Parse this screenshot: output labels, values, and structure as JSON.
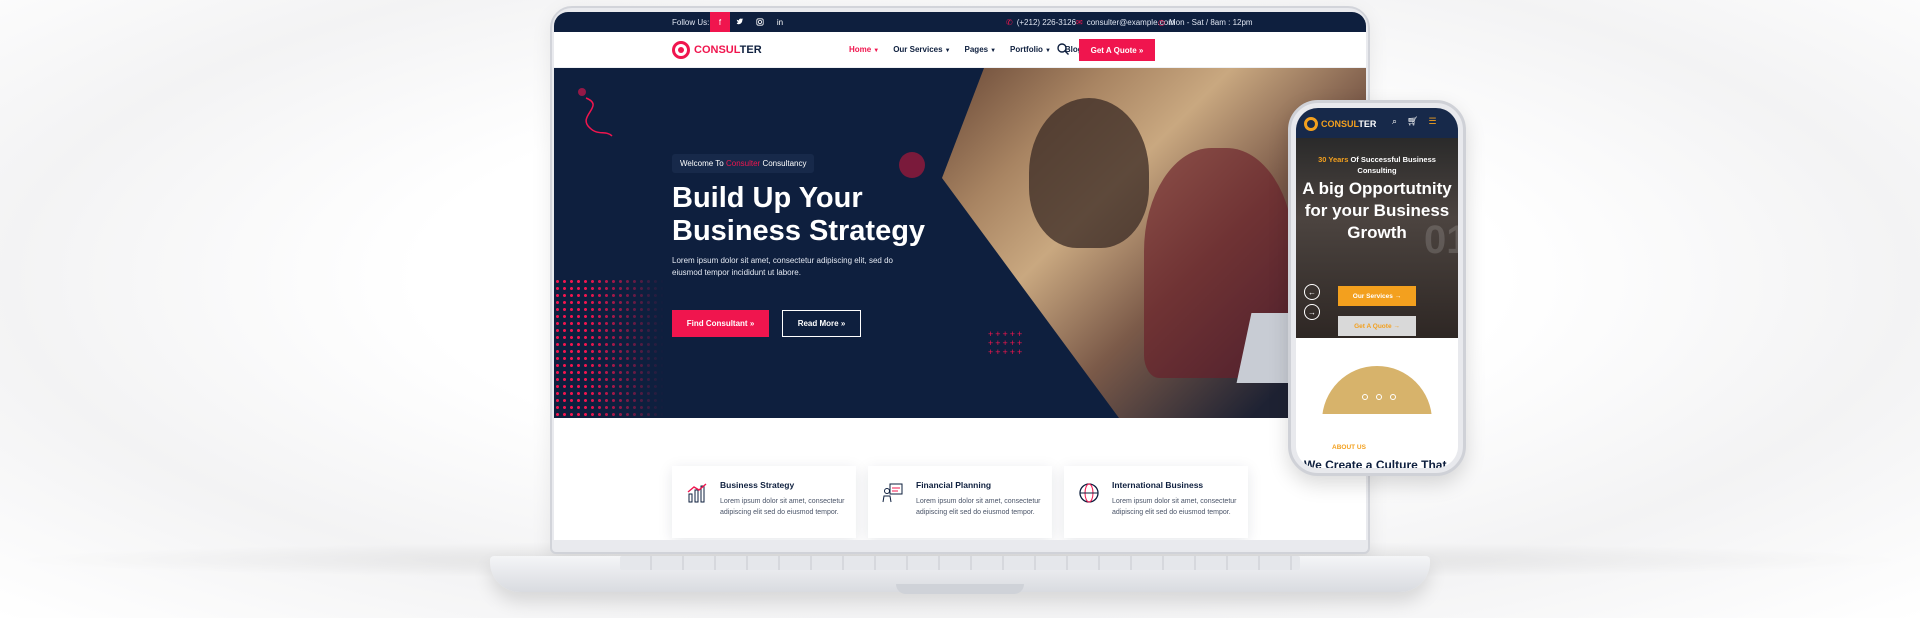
{
  "topbar": {
    "follow_label": "Follow Us:",
    "phone": "(+212) 226-3126",
    "email": "consulter@example.com",
    "hours": "Mon - Sat / 8am : 12pm"
  },
  "brand": {
    "part1": "CONSUL",
    "part2": "TER"
  },
  "nav": {
    "items": [
      {
        "label": "Home"
      },
      {
        "label": "Our Services"
      },
      {
        "label": "Pages"
      },
      {
        "label": "Portfolio"
      },
      {
        "label": "Blog"
      }
    ],
    "quote_label": "Get A Quote"
  },
  "hero": {
    "welcome_prefix": "Welcome To",
    "welcome_brand": "Consulter",
    "welcome_suffix": "Consultancy",
    "title_line1": "Build Up Your",
    "title_line2": "Business Strategy",
    "description": "Lorem ipsum dolor sit amet, consectetur adipiscing elit, sed do eiusmod tempor incididunt ut labore.",
    "primary_button": "Find Consultant",
    "secondary_button": "Read More"
  },
  "services": [
    {
      "title": "Business Strategy",
      "desc": "Lorem ipsum dolor sit amet, consectetur adipiscing elit sed do eiusmod tempor."
    },
    {
      "title": "Financial Planning",
      "desc": "Lorem ipsum dolor sit amet, consectetur adipiscing elit sed do eiusmod tempor."
    },
    {
      "title": "International Business",
      "desc": "Lorem ipsum dolor sit amet, consectetur adipiscing elit sed do eiusmod tempor."
    }
  ],
  "mobile": {
    "brand_part1": "CONSUL",
    "brand_part2": "TER",
    "sub_years": "30 Years",
    "sub_rest": "Of Successful Business Consulting",
    "headline": "A big Opportutnity for your Business Growth",
    "ghost_number": "01",
    "services_button": "Our Services",
    "quote_button": "Get A Quote",
    "about_label": "ABOUT US",
    "culture_text": "We Create a Culture That"
  },
  "colors": {
    "navy": "#0e1f3e",
    "accent": "#f0154e",
    "mobile_accent": "#f3a01e"
  }
}
